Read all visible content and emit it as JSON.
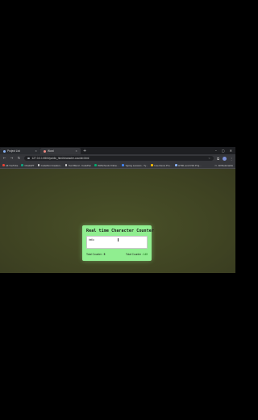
{
  "browser": {
    "tabs": [
      {
        "label": "Project List"
      },
      {
        "label": "Word"
      }
    ],
    "new_tab": "+",
    "window_controls": [
      "–",
      "▢",
      "✕"
    ],
    "url": "127.0.0.1:5500/public_html/character-counter.html",
    "bookmarks": [
      {
        "label": "All YouTube",
        "color": "#ea4335"
      },
      {
        "label": "ChatGPT",
        "color": "#10a37f"
      },
      {
        "label": "CodePen Creation...",
        "color": "#cfcfcf"
      },
      {
        "label": "Text Blend - CodePen",
        "color": "#cfcfcf"
      },
      {
        "label": "W3Schools Online...",
        "color": "#04aa6d"
      },
      {
        "label": "Typing Lessons - Ty...",
        "color": "#4285f4"
      },
      {
        "label": "Live Demo Pro...",
        "color": "#fbbc05"
      },
      {
        "label": "HTML and CSS Proj...",
        "color": "#8ab4f8"
      }
    ],
    "all_bookmarks": "All Bookmarks"
  },
  "app": {
    "title": "Real time Character Counter",
    "textarea_value": "hello",
    "total_counter_label": "Total Counter :",
    "total_counter_value": "5",
    "remaining_counter_label": "Total Counter :",
    "remaining_counter_value": "145"
  },
  "colors": {
    "card_bg": "#90ee90",
    "page_bg": "#3e4222"
  }
}
